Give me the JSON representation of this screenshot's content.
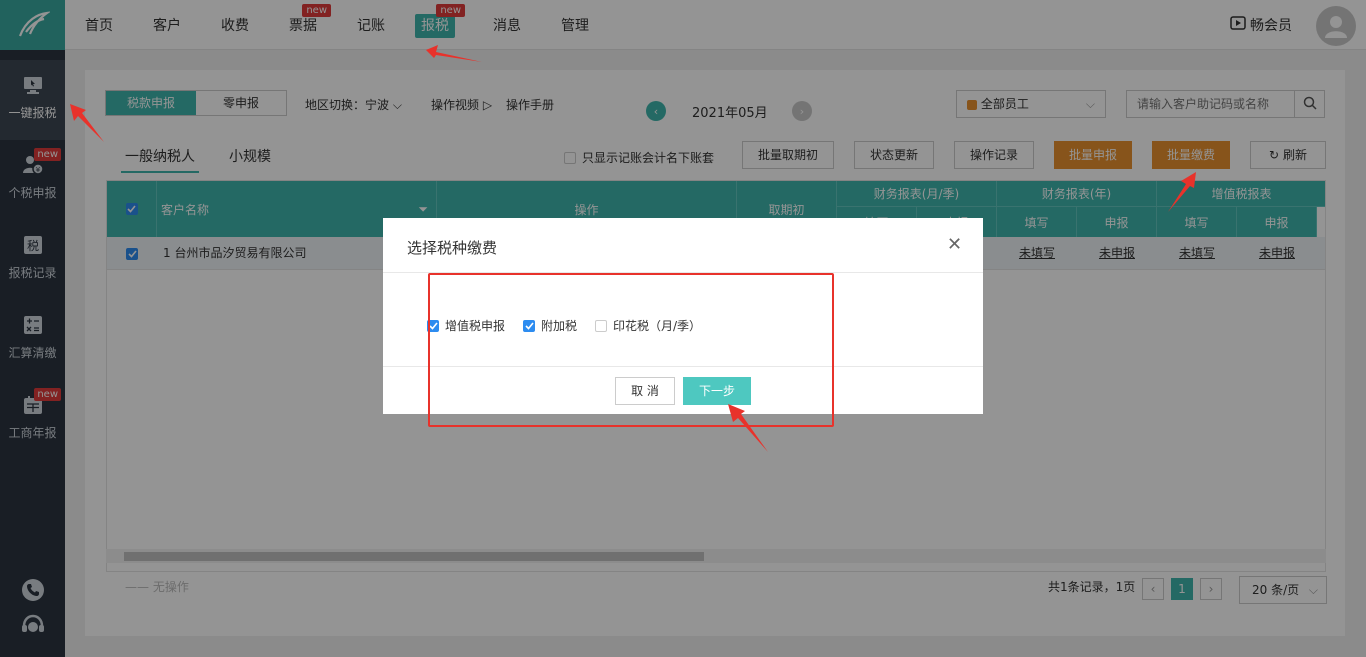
{
  "sidebar": {
    "items": [
      {
        "label": "一键报税",
        "icon": "monitor-icon",
        "active": true,
        "badge": ""
      },
      {
        "label": "个税申报",
        "icon": "person-tax-icon",
        "active": false,
        "badge": "new"
      },
      {
        "label": "报税记录",
        "icon": "tax-record-icon",
        "active": false,
        "badge": ""
      },
      {
        "label": "汇算清缴",
        "icon": "calculator-icon",
        "active": false,
        "badge": ""
      },
      {
        "label": "工商年报",
        "icon": "calendar-icon",
        "active": false,
        "badge": "new"
      }
    ],
    "bottom_icons": [
      "phone-icon",
      "headset-icon"
    ]
  },
  "topnav": {
    "items": [
      {
        "label": "首页",
        "badge": ""
      },
      {
        "label": "客户",
        "badge": ""
      },
      {
        "label": "收费",
        "badge": ""
      },
      {
        "label": "票据",
        "badge": "new"
      },
      {
        "label": "记账",
        "badge": ""
      },
      {
        "label": "报税",
        "badge": "new",
        "active": true
      },
      {
        "label": "消息",
        "badge": ""
      },
      {
        "label": "管理",
        "badge": ""
      }
    ],
    "member_label": "畅会员"
  },
  "toolbar": {
    "seg_tabs": [
      "税款申报",
      "零申报"
    ],
    "region_label": "地区切换：宁波",
    "video_label": "操作视频",
    "manual_label": "操作手册",
    "period": "2021年05月",
    "employee_select": "全部员工",
    "search_placeholder": "请输入客户助记码或名称"
  },
  "subtabs": [
    "一般纳税人",
    "小规模"
  ],
  "only_show_label": "只显示记账会计名下账套",
  "buttons": {
    "batch_cancel_initial": "批量取期初",
    "status_update": "状态更新",
    "operation_log": "操作记录",
    "batch_declare": "批量申报",
    "batch_pay": "批量缴费",
    "refresh": "刷新"
  },
  "table": {
    "headers": {
      "customer_name": "客户名称",
      "operation": "操作",
      "take_initial": "取期初",
      "fin_report_monthly": "财务报表(月/季)",
      "fin_report_yearly": "财务报表(年)",
      "vat_report": "增值税报表",
      "fill": "填写",
      "declare": "申报",
      "fill_partial": "填写",
      "declare_partial": "申报"
    },
    "rows": [
      {
        "index": "1",
        "name": "台州市品汐贸易有限公司",
        "cells": [
          "未填写",
          "未申报",
          "未填写",
          "未申报"
        ]
      }
    ]
  },
  "footer": {
    "no_op": "—— 无操作",
    "total": "共1条记录，1页",
    "current_page": "1",
    "page_size": "20 条/页"
  },
  "modal": {
    "title": "选择税种缴费",
    "options": [
      {
        "label": "增值税申报",
        "checked": true
      },
      {
        "label": "附加税",
        "checked": true
      },
      {
        "label": "印花税（月/季）",
        "checked": false
      }
    ],
    "cancel_label": "取 消",
    "next_label": "下一步"
  },
  "colors": {
    "teal": "#3fb6ad",
    "orange": "#e9912f",
    "sidebar": "#2b3440",
    "annotation_red": "#e8322b"
  }
}
